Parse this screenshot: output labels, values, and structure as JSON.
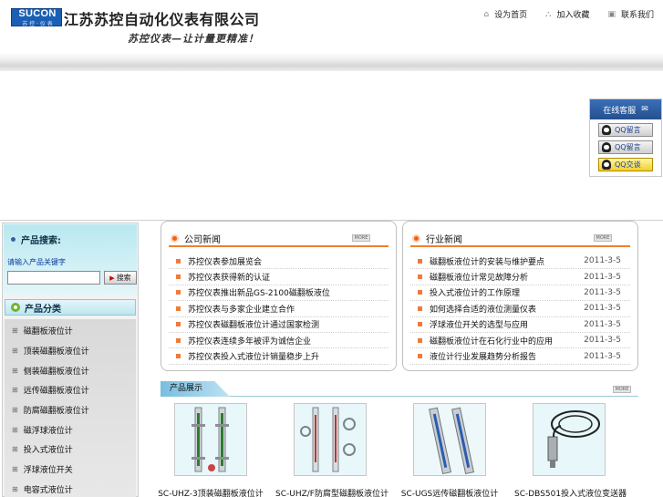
{
  "header": {
    "logo_en": "SUCON",
    "logo_cn": "苏 控 · 仪 表",
    "company_name": "江苏苏控自动化仪表有限公司",
    "slogan": "苏控仪表—让计量更精准！",
    "nav": [
      {
        "label": "设为首页",
        "icon": "home-icon",
        "glyph": "⌂"
      },
      {
        "label": "加入收藏",
        "icon": "bookmark-icon",
        "glyph": "⛬"
      },
      {
        "label": "联系我们",
        "icon": "contact-icon",
        "glyph": "▣"
      }
    ]
  },
  "service": {
    "title": "在线客服",
    "buttons": [
      "QQ留言",
      "QQ留言",
      "QQ交谈"
    ]
  },
  "sidebar": {
    "search_title": "产品搜索:",
    "search_hint": "请输入产品关键字",
    "search_value": "",
    "search_button": "搜索",
    "category_title": "产品分类",
    "categories": [
      "磁翻板液位计",
      "顶装磁翻板液位计",
      "侧装磁翻板液位计",
      "远传磁翻板液位计",
      "防腐磁翻板液位计",
      "磁浮球液位计",
      "投入式液位计",
      "浮球液位开关",
      "电容式液位计"
    ]
  },
  "news_left": {
    "title": "公司新闻",
    "more": "MORE",
    "items": [
      "苏控仪表参加展览会",
      "苏控仪表获得新的认证",
      "苏控仪表推出新品GS-2100磁翻板液位",
      "苏控仪表与多家企业建立合作",
      "苏控仪表磁翻板液位计通过国家检测",
      "苏控仪表连续多年被评为诚信企业",
      "苏控仪表投入式液位计销量稳步上升"
    ]
  },
  "news_right": {
    "title": "行业新闻",
    "more": "MORE",
    "items": [
      {
        "text": "磁翻板液位计的安装与维护要点",
        "date": "2011-3-5"
      },
      {
        "text": "磁翻板液位计常见故障分析",
        "date": "2011-3-5"
      },
      {
        "text": "投入式液位计的工作原理",
        "date": "2011-3-5"
      },
      {
        "text": "如何选择合适的液位测量仪表",
        "date": "2011-3-5"
      },
      {
        "text": "浮球液位开关的选型与应用",
        "date": "2011-3-5"
      },
      {
        "text": "磁翻板液位计在石化行业中的应用",
        "date": "2011-3-5"
      },
      {
        "text": "液位计行业发展趋势分析报告",
        "date": "2011-3-5"
      }
    ]
  },
  "products": {
    "title": "产品展示",
    "more": "MORE",
    "items": [
      {
        "name": "SC-UHZ-3顶装磁翻板液位计",
        "kind": "twin"
      },
      {
        "name": "SC-UHZ/F防腐型磁翻板液位计",
        "kind": "twin-flange"
      },
      {
        "name": "SC-UGS远传磁翻板液位计",
        "kind": "twin-steel"
      },
      {
        "name": "SC-DBS501投入式液位变送器",
        "kind": "probe"
      }
    ]
  }
}
